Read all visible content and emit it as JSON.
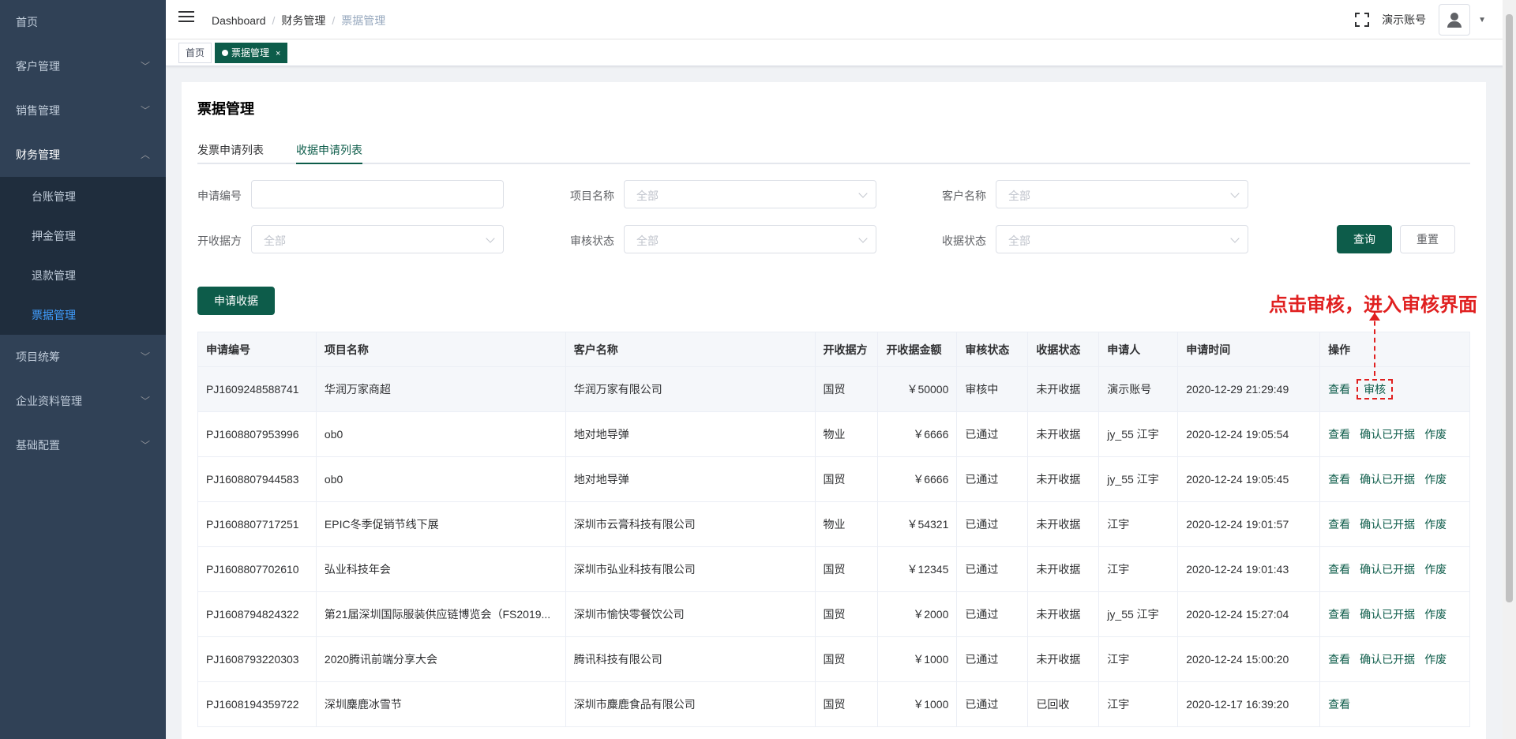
{
  "sidebar": {
    "items": [
      {
        "label": "首页"
      },
      {
        "label": "客户管理"
      },
      {
        "label": "销售管理"
      },
      {
        "label": "财务管理"
      },
      {
        "label": "项目统筹"
      },
      {
        "label": "企业资料管理"
      },
      {
        "label": "基础配置"
      }
    ],
    "finance_sub": [
      "台账管理",
      "押金管理",
      "退款管理",
      "票据管理"
    ]
  },
  "header": {
    "breadcrumb": [
      "Dashboard",
      "财务管理",
      "票据管理"
    ],
    "account": "演示账号"
  },
  "tags": {
    "home": "首页",
    "active": "票据管理",
    "close": "×"
  },
  "page": {
    "title": "票据管理",
    "tabs": [
      "发票申请列表",
      "收据申请列表"
    ],
    "filters": {
      "apply_no_label": "申请编号",
      "project_label": "项目名称",
      "customer_label": "客户名称",
      "issuer_label": "开收据方",
      "audit_label": "审核状态",
      "receipt_label": "收据状态",
      "all": "全部"
    },
    "query_btn": "查询",
    "reset_btn": "重置",
    "apply_btn": "申请收据"
  },
  "table": {
    "headers": [
      "申请编号",
      "项目名称",
      "客户名称",
      "开收据方",
      "开收据金额",
      "审核状态",
      "收据状态",
      "申请人",
      "申请时间",
      "操作"
    ],
    "rows": [
      {
        "no": "PJ1609248588741",
        "project": "华润万家商超",
        "customer": "华润万家有限公司",
        "issuer": "国贸",
        "amount": "￥50000",
        "audit": "审核中",
        "status": "未开收据",
        "applicant": "演示账号",
        "time": "2020-12-29 21:29:49",
        "ops": [
          "查看",
          "审核"
        ]
      },
      {
        "no": "PJ1608807953996",
        "project": "ob0",
        "customer": "地对地导弹",
        "issuer": "物业",
        "amount": "￥6666",
        "audit": "已通过",
        "status": "未开收据",
        "applicant": "jy_55 江宇",
        "time": "2020-12-24 19:05:54",
        "ops": [
          "查看",
          "确认已开据",
          "作废"
        ]
      },
      {
        "no": "PJ1608807944583",
        "project": "ob0",
        "customer": "地对地导弹",
        "issuer": "国贸",
        "amount": "￥6666",
        "audit": "已通过",
        "status": "未开收据",
        "applicant": "jy_55 江宇",
        "time": "2020-12-24 19:05:45",
        "ops": [
          "查看",
          "确认已开据",
          "作废"
        ]
      },
      {
        "no": "PJ1608807717251",
        "project": "EPIC冬季促销节线下展",
        "customer": "深圳市云膏科技有限公司",
        "issuer": "物业",
        "amount": "￥54321",
        "audit": "已通过",
        "status": "未开收据",
        "applicant": "江宇",
        "time": "2020-12-24 19:01:57",
        "ops": [
          "查看",
          "确认已开据",
          "作废"
        ]
      },
      {
        "no": "PJ1608807702610",
        "project": "弘业科技年会",
        "customer": "深圳市弘业科技有限公司",
        "issuer": "国贸",
        "amount": "￥12345",
        "audit": "已通过",
        "status": "未开收据",
        "applicant": "江宇",
        "time": "2020-12-24 19:01:43",
        "ops": [
          "查看",
          "确认已开据",
          "作废"
        ]
      },
      {
        "no": "PJ1608794824322",
        "project": "第21届深圳国际服装供应链博览会（FS2019...",
        "customer": "深圳市愉快零餐饮公司",
        "issuer": "国贸",
        "amount": "￥2000",
        "audit": "已通过",
        "status": "未开收据",
        "applicant": "jy_55 江宇",
        "time": "2020-12-24 15:27:04",
        "ops": [
          "查看",
          "确认已开据",
          "作废"
        ]
      },
      {
        "no": "PJ1608793220303",
        "project": "2020腾讯前端分享大会",
        "customer": "腾讯科技有限公司",
        "issuer": "国贸",
        "amount": "￥1000",
        "audit": "已通过",
        "status": "未开收据",
        "applicant": "江宇",
        "time": "2020-12-24 15:00:20",
        "ops": [
          "查看",
          "确认已开据",
          "作废"
        ]
      },
      {
        "no": "PJ1608194359722",
        "project": "深圳麋鹿冰雪节",
        "customer": "深圳市麋鹿食品有限公司",
        "issuer": "国贸",
        "amount": "￥1000",
        "audit": "已通过",
        "status": "已回收",
        "applicant": "江宇",
        "time": "2020-12-17 16:39:20",
        "ops": [
          "查看"
        ]
      }
    ]
  },
  "annotation": "点击审核，进入审核界面",
  "colors": {
    "primary": "#0d5c4a",
    "sidebar": "#304156",
    "annotation": "#e02020"
  }
}
